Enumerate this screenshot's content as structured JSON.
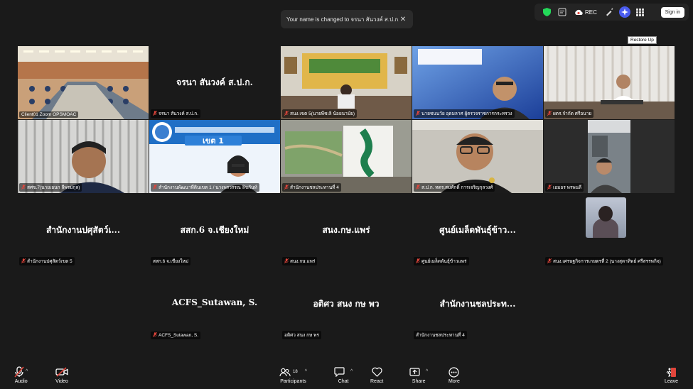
{
  "toast": {
    "message": "Your name is changed to จรนา สันวงค์ ส.ป.ก."
  },
  "topbar": {
    "rec_label": "REC",
    "signin_label": "Sign in",
    "restore_tooltip": "Restore Up"
  },
  "tiles": [
    {
      "type": "video",
      "name": "Client01 Zoom OPSMOAC",
      "muted": false,
      "active": true,
      "scene": "meeting-room"
    },
    {
      "type": "name",
      "display": "จรนา สันวงค์ ส.ป.ก.",
      "name": "จรนา สันวงค์ ส.ป.ก.",
      "muted": true
    },
    {
      "type": "video",
      "name": "สนง.เขต 5(นายพีชเลิ น้อยนามัย)",
      "muted": true,
      "scene": "office-wall"
    },
    {
      "type": "video",
      "name": "นายชนนวัย อุดมลาศ ผู้ตรวจราชการกระทรวง",
      "muted": true,
      "scene": "man-blue"
    },
    {
      "type": "video",
      "name": "ผตร.จำกัด ศรีอนาย",
      "muted": true,
      "scene": "man-desk"
    },
    {
      "type": "video",
      "name": "สศข.7(นายเอนก ลีพรมกุล)",
      "muted": true,
      "scene": "man-blinds"
    },
    {
      "type": "video",
      "name": "สำนักงานพัฒนาที่ดินเขต 1 / นางพรวรรณ ลิขกันท์",
      "muted": true,
      "scene": "woman-banner",
      "banner": "เขต 1"
    },
    {
      "type": "video",
      "name": "สำนักงานชลประทานที่ 4",
      "muted": true,
      "scene": "map"
    },
    {
      "type": "video",
      "name": "ส.ป.ก. ทดร.สมศักดิ์ การเจริญกุลวงศ์",
      "muted": true,
      "scene": "man-glasses"
    },
    {
      "type": "video",
      "name": "เอมอร พรพนลี",
      "muted": true,
      "scene": "woman-car"
    },
    {
      "type": "name",
      "display": "สำนักงานปศุสัตว์เ...",
      "name": "สำนักงานปศุสัตว์เขต 5",
      "muted": true
    },
    {
      "type": "name",
      "display": "สสก.6 จ.เชียงใหม่",
      "name": "สสก.6 จ.เชียงใหม่",
      "muted": false
    },
    {
      "type": "name",
      "display": "สนง.กษ.แพร่",
      "name": "สนง.กษ.แพร่",
      "muted": true
    },
    {
      "type": "name",
      "display": "ศูนย์เมล็ดพันธุ์ข้าว...",
      "name": "ศูนย์เมล็ดพันธุ์ข้าวแพร่",
      "muted": true
    },
    {
      "type": "avatar",
      "name": "สนง.เศรษฐกิจการเกษตรที่ 2 (นางสุดาทิพย์ ศรีสรรพกิจ)",
      "muted": true
    },
    {
      "type": "empty"
    },
    {
      "type": "name",
      "display": "ACFS_Sutawan, S.",
      "name": "ACFS_Sutawan, S.",
      "muted": true
    },
    {
      "type": "name",
      "display": "อติศว สนง กษ พว",
      "name": "อติศว สนง กษ พร",
      "muted": false
    },
    {
      "type": "name",
      "display": "สำนักงานชลประท...",
      "name": "สำนักงานชลประทานที่ 4",
      "muted": false
    },
    {
      "type": "empty"
    }
  ],
  "bottombar": {
    "audio": "Audio",
    "video": "Video",
    "participants": "Participants",
    "participants_count": "18",
    "chat": "Chat",
    "react": "React",
    "share": "Share",
    "more": "More",
    "leave": "Leave"
  },
  "colors": {
    "active_speaker": "#23d959",
    "mute": "#e0453b",
    "background": "#1a1a1a"
  }
}
